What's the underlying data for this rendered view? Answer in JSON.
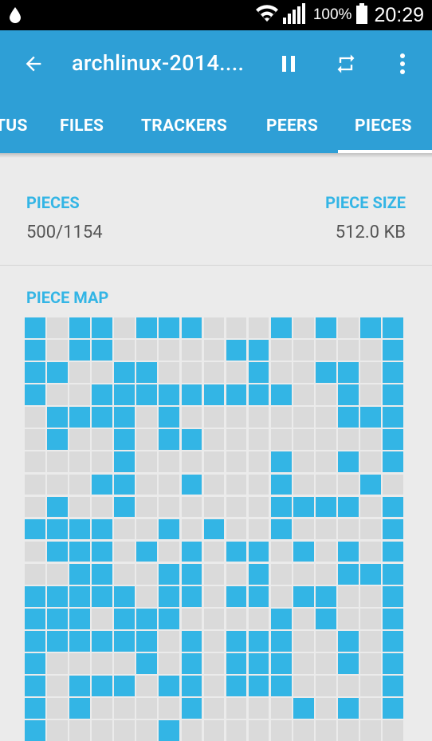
{
  "status_bar": {
    "battery_percent": "100%",
    "time": "20:29",
    "icons": [
      "drop-icon",
      "wifi-icon",
      "signal-icon",
      "battery-icon"
    ]
  },
  "app_bar": {
    "title": "archlinux-2014....",
    "icons": [
      "back-arrow-icon",
      "pause-icon",
      "repeat-icon",
      "more-vert-icon"
    ]
  },
  "tabs": [
    {
      "label": "TUS"
    },
    {
      "label": "FILES"
    },
    {
      "label": "TRACKERS"
    },
    {
      "label": "PEERS"
    },
    {
      "label": "PIECES",
      "selected": true
    }
  ],
  "info": {
    "pieces_label": "PIECES",
    "pieces_value": "500/1154",
    "piece_size_label": "PIECE SIZE",
    "piece_size_value": "512.0 KB"
  },
  "piece_map": {
    "label": "PIECE MAP",
    "columns": 17,
    "colors": {
      "have": "#33b5e5",
      "missing": "#dadada"
    },
    "rows": [
      "10110111000101011",
      "10110000011000001",
      "11001100001001101",
      "10011111111100101",
      "01111010000000111",
      "01001011000000001",
      "00001000000100101",
      "00011001000100010",
      "01001000000111101",
      "11110010100100001",
      "01110101011010101",
      "00110011001000111",
      "11111011011011001",
      "11101110000101001",
      "11111101011100101",
      "10000101011100101",
      "10111011011100001",
      "10100001000010101",
      "10000010000000000"
    ]
  }
}
